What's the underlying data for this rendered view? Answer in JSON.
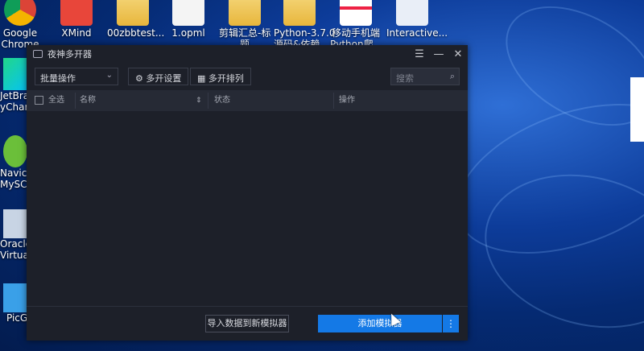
{
  "desktop": {
    "icons": [
      {
        "label": "Google\nChrome",
        "icon": "chrome-icon"
      },
      {
        "label": "XMind",
        "icon": "xmind-icon"
      },
      {
        "label": "00zbbtest...",
        "icon": "folder-icon"
      },
      {
        "label": "1.opml",
        "icon": "document-icon"
      },
      {
        "label": "剪辑汇总-标\n题",
        "icon": "folder-icon"
      },
      {
        "label": "Python-3.7.0\n源码&依赖...",
        "icon": "folder-icon"
      },
      {
        "label": "移动手机端\nPython爬...",
        "icon": "document-icon"
      },
      {
        "label": "Interactive...",
        "icon": "app-icon"
      }
    ],
    "side_icons": [
      {
        "label": "JetBra\nyCharm",
        "icon": "pycharm-icon"
      },
      {
        "label": "Navica\nMySC",
        "icon": "navicat-icon"
      },
      {
        "label": "Oracle\nVirtual",
        "icon": "virtualbox-icon"
      },
      {
        "label": "PicG",
        "icon": "picgo-icon"
      }
    ]
  },
  "app": {
    "title": "夜神多开器",
    "window_controls": {
      "menu": "☰",
      "minimize": "—",
      "close": "✕"
    },
    "toolbar": {
      "batch_select": "批量操作",
      "multi_settings": "多开设置",
      "multi_arrange": "多开排列",
      "search_placeholder": "搜索"
    },
    "table": {
      "select_all": "全选",
      "columns": {
        "name": "名称",
        "status": "状态",
        "action": "操作"
      }
    },
    "footer": {
      "import_label": "导入数据到新模拟器",
      "add_label": "添加模拟器",
      "more_label": "⋮"
    }
  },
  "colors": {
    "accent": "#1479e6",
    "window_bg": "#1d2029",
    "header_bg": "#262a35"
  }
}
